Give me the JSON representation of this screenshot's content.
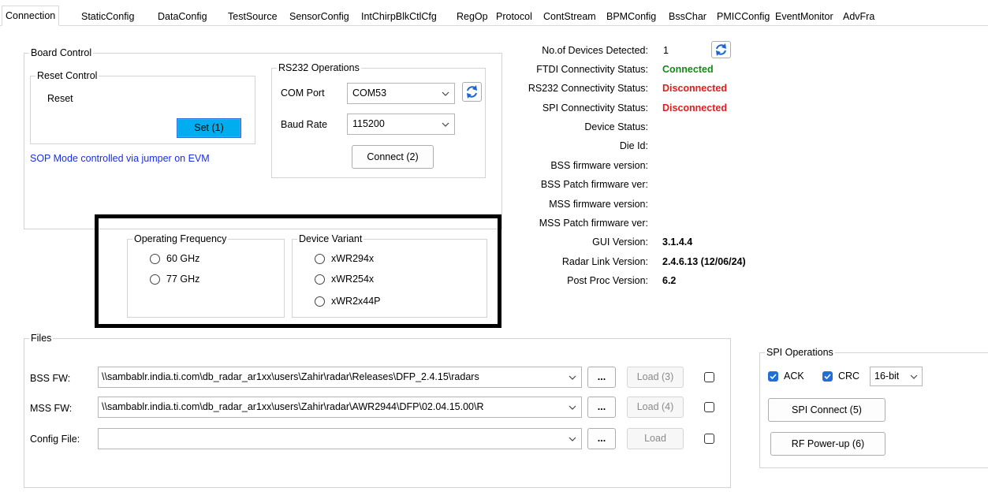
{
  "tabs": [
    "Connection",
    "StaticConfig",
    "DataConfig",
    "TestSource",
    "SensorConfig",
    "IntChirpBlkCtlCfg",
    "RegOp",
    "Protocol",
    "ContStream",
    "BPMConfig",
    "BssChar",
    "PMICConfig",
    "EventMonitor",
    "AdvFra"
  ],
  "board_control": {
    "title": "Board Control",
    "reset_control": {
      "title": "Reset Control",
      "reset_label": "Reset",
      "set_button": "Set (1)"
    },
    "sop_note": "SOP Mode controlled via jumper on EVM"
  },
  "rs232": {
    "title": "RS232 Operations",
    "com_port_label": "COM Port",
    "com_port_value": "COM53",
    "baud_rate_label": "Baud Rate",
    "baud_rate_value": "115200",
    "connect_button": "Connect (2)"
  },
  "operating_frequency": {
    "title": "Operating Frequency",
    "options": [
      "60 GHz",
      "77 GHz"
    ]
  },
  "device_variant": {
    "title": "Device Variant",
    "options": [
      "xWR294x",
      "xWR254x",
      "xWR2x44P"
    ]
  },
  "status": {
    "devices_detected_label": "No.of Devices Detected:",
    "devices_detected_value": "1",
    "ftdi_label": "FTDI Connectivity Status:",
    "ftdi_value": "Connected",
    "rs232_label": "RS232 Connectivity Status:",
    "rs232_value": "Disconnected",
    "spi_label": "SPI Connectivity Status:",
    "spi_value": "Disconnected",
    "device_status_label": "Device Status:",
    "die_id_label": "Die Id:",
    "bss_fw_label": "BSS firmware version:",
    "bss_patch_label": "BSS Patch firmware ver:",
    "mss_fw_label": "MSS firmware version:",
    "mss_patch_label": "MSS Patch firmware ver:",
    "gui_version_label": "GUI Version:",
    "gui_version_value": "3.1.4.4",
    "radar_link_label": "Radar Link Version:",
    "radar_link_value": "2.4.6.13 (12/06/24)",
    "post_proc_label": "Post Proc Version:",
    "post_proc_value": "6.2"
  },
  "files": {
    "title": "Files",
    "bss_label": "BSS FW:",
    "bss_path": "\\\\sambablr.india.ti.com\\db_radar_ar1xx\\users\\Zahir\\radar\\Releases\\DFP_2.4.15\\radars",
    "bss_load": "Load (3)",
    "mss_label": "MSS FW:",
    "mss_path": "\\\\sambablr.india.ti.com\\db_radar_ar1xx\\users\\Zahir\\radar\\AWR2944\\DFP\\02.04.15.00\\R",
    "mss_load": "Load (4)",
    "config_label": "Config File:",
    "config_path": "",
    "config_load": "Load",
    "browse": "..."
  },
  "spi": {
    "title": "SPI Operations",
    "ack_label": "ACK",
    "crc_label": "CRC",
    "crc_bits": "16-bit",
    "spi_connect": "SPI Connect (5)",
    "rf_powerup": "RF Power-up (6)"
  },
  "colors": {
    "connected": "#138a13",
    "disconnected": "#e31b1b",
    "set_button": "#00aeef",
    "checkbox_on": "#1f6fd6"
  }
}
